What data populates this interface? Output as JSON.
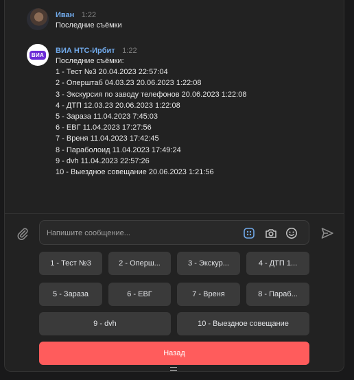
{
  "messages": [
    {
      "author": "Иван",
      "time": "1:22",
      "lines": [
        "Последние съёмки"
      ]
    },
    {
      "author": "ВИА НТС-Ирбит",
      "time": "1:22",
      "avatar_text": "ВИА",
      "lines": [
        "Последние съёмки:",
        "1 - Тест №3 20.04.2023 22:57:04",
        "2 - Оперштаб 04.03.23 20.06.2023 1:22:08",
        "3 - Экскурсия по заводу телефонов 20.06.2023 1:22:08",
        "4 - ДТП 12.03.23 20.06.2023 1:22:08",
        "5 - Зараза 11.04.2023 7:45:03",
        "6 - ЕВГ 11.04.2023 17:27:56",
        "7 - Вреня 11.04.2023 17:42:45",
        "8 - Параболоид 11.04.2023 17:49:24",
        "9 - dvh 11.04.2023 22:57:26",
        "10 - Выездное совещание 20.06.2023 1:21:56"
      ]
    }
  ],
  "composer": {
    "placeholder": "Напишите сообщение..."
  },
  "keyboard": {
    "row1": [
      "1 - Тест №3",
      "2 - Оперш...",
      "3 - Экскур...",
      "4 - ДТП 1..."
    ],
    "row2": [
      "5 - Зараза",
      "6 - ЕВГ",
      "7 - Вреня",
      "8 - Параб..."
    ],
    "row3": [
      "9 - dvh",
      "10 - Выездное совещание"
    ],
    "back": "Назад"
  },
  "colors": {
    "background": "#222222",
    "author": "#71aaeb",
    "button": "#3a3a3a",
    "back_button": "#ff5c5c",
    "accent_icon": "#71aaeb"
  },
  "icons": {
    "attach": "paperclip-icon",
    "keyboard": "bot-keyboard-icon",
    "camera": "camera-icon",
    "emoji": "smile-icon",
    "send": "send-icon"
  }
}
